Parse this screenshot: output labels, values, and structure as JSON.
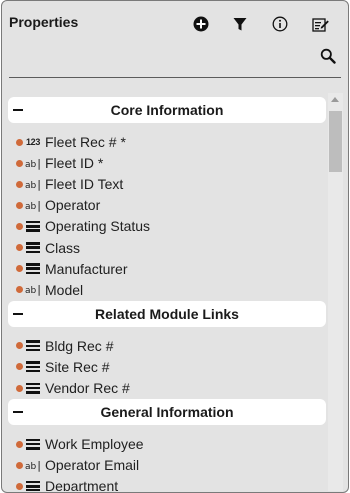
{
  "panel": {
    "title": "Properties"
  },
  "toolbar": {
    "icons": [
      "add-icon",
      "filter-icon",
      "info-icon",
      "edit-layout-icon",
      "search-icon"
    ]
  },
  "sections": [
    {
      "label": "Core Information",
      "items": [
        {
          "label": "Fleet Rec # *",
          "type": "number"
        },
        {
          "label": "Fleet ID *",
          "type": "text"
        },
        {
          "label": "Fleet ID Text",
          "type": "text"
        },
        {
          "label": "Operator",
          "type": "text"
        },
        {
          "label": "Operating Status",
          "type": "list"
        },
        {
          "label": "Class",
          "type": "list"
        },
        {
          "label": "Manufacturer",
          "type": "list"
        },
        {
          "label": "Model",
          "type": "text"
        }
      ]
    },
    {
      "label": "Related Module Links",
      "items": [
        {
          "label": "Bldg Rec #",
          "type": "list"
        },
        {
          "label": "Site Rec #",
          "type": "list"
        },
        {
          "label": "Vendor Rec #",
          "type": "list"
        }
      ]
    },
    {
      "label": "General Information",
      "items": [
        {
          "label": "Work Employee",
          "type": "list"
        },
        {
          "label": "Operator Email",
          "type": "text"
        },
        {
          "label": "Department",
          "type": "list"
        }
      ]
    }
  ],
  "type_glyphs": {
    "number": "123",
    "text": "ab",
    "text_cursor": "|"
  },
  "colors": {
    "required_dot": "#d06a3a",
    "panel_bg": "#e3e3e3",
    "header_bg": "#ffffff"
  }
}
